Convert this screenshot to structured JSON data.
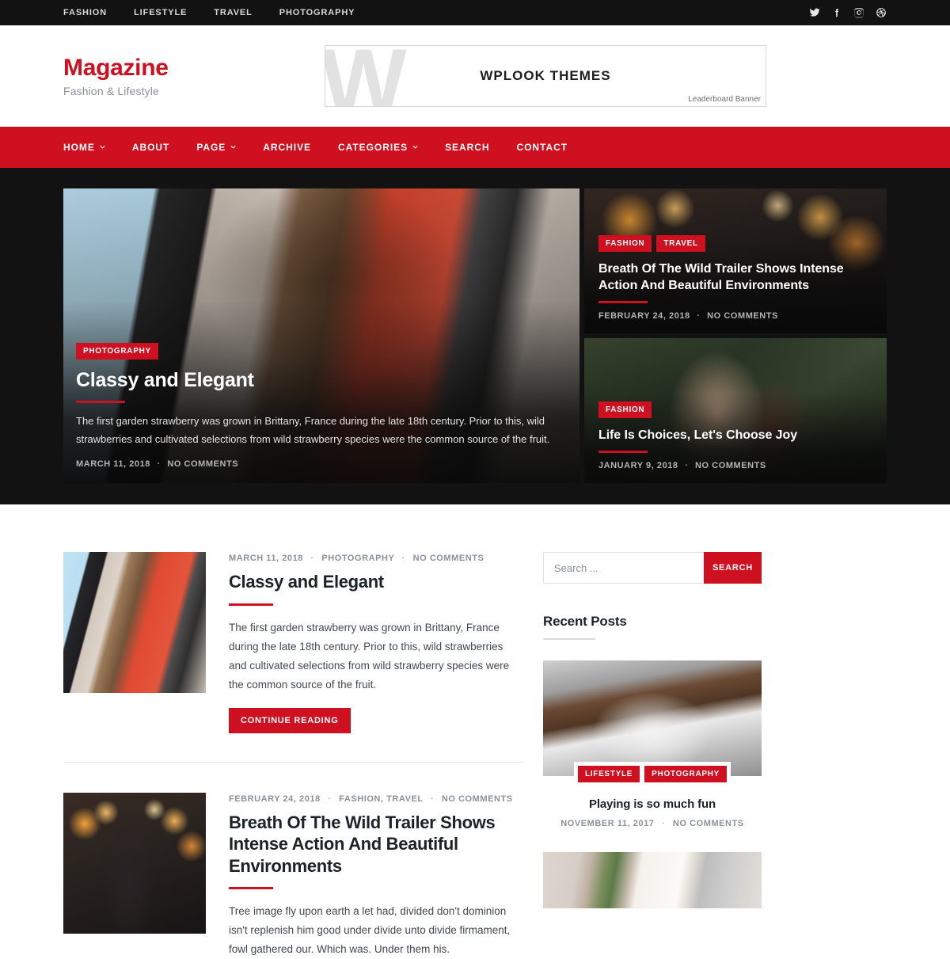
{
  "topbar": {
    "links": [
      "FASHION",
      "LIFESTYLE",
      "TRAVEL",
      "PHOTOGRAPHY"
    ],
    "social": [
      "twitter-icon",
      "facebook-icon",
      "instagram-icon",
      "dribbble-icon"
    ]
  },
  "header": {
    "logo": "Magazine",
    "tagline": "Fashion & Lifestyle",
    "banner": {
      "watermark": "W",
      "title": "WPLOOK THEMES",
      "note": "Leaderboard Banner"
    }
  },
  "mainnav": {
    "items": [
      {
        "label": "HOME",
        "caret": true
      },
      {
        "label": "ABOUT",
        "caret": false
      },
      {
        "label": "PAGE",
        "caret": true
      },
      {
        "label": "ARCHIVE",
        "caret": false
      },
      {
        "label": "CATEGORIES",
        "caret": true
      },
      {
        "label": "SEARCH",
        "caret": false
      },
      {
        "label": "CONTACT",
        "caret": false
      }
    ]
  },
  "hero": {
    "featured": {
      "categories": [
        "PHOTOGRAPHY"
      ],
      "title": "Classy and Elegant",
      "excerpt": "The first garden strawberry was grown in Brittany, France during the late 18th century. Prior to this, wild strawberries and cultivated selections from wild strawberry species were the common source of the fruit.",
      "date": "MARCH 11, 2018",
      "comments": "NO COMMENTS"
    },
    "side": [
      {
        "categories": [
          "FASHION",
          "TRAVEL"
        ],
        "title": "Breath Of The Wild Trailer Shows Intense Action And Beautiful Environments",
        "date": "FEBRUARY 24, 2018",
        "comments": "NO COMMENTS"
      },
      {
        "categories": [
          "FASHION"
        ],
        "title": "Life Is Choices, Let's Choose Joy",
        "date": "JANUARY 9, 2018",
        "comments": "NO COMMENTS"
      }
    ]
  },
  "posts": [
    {
      "date": "MARCH 11, 2018",
      "categories": "PHOTOGRAPHY",
      "comments": "NO COMMENTS",
      "title": "Classy and Elegant",
      "excerpt": "The first garden strawberry was grown in Brittany, France during the late 18th century. Prior to this, wild strawberries and cultivated selections from wild strawberry species were the common source of the fruit.",
      "cta": "CONTINUE READING"
    },
    {
      "date": "FEBRUARY 24, 2018",
      "categories": "FASHION, TRAVEL",
      "comments": "NO COMMENTS",
      "title": "Breath Of The Wild Trailer Shows Intense Action And Beautiful Environments",
      "excerpt": "Tree image fly upon earth a let had, divided don't dominion isn't replenish him good under divide unto divide firmament, fowl gathered our. Which was. Under them his.",
      "cta": "CONTINUE READING"
    }
  ],
  "sidebar": {
    "search": {
      "placeholder": "Search ...",
      "value": "",
      "button": "SEARCH"
    },
    "recent_posts": {
      "title": "Recent Posts",
      "items": [
        {
          "categories": [
            "LIFESTYLE",
            "PHOTOGRAPHY"
          ],
          "title": "Playing is so much fun",
          "date": "NOVEMBER 11, 2017",
          "comments": "NO COMMENTS"
        },
        {
          "categories": [],
          "title": "",
          "date": "",
          "comments": ""
        }
      ]
    }
  },
  "colors": {
    "accent": "#cf1020",
    "dark": "#121212",
    "text": "#1d2226",
    "muted": "#8d9197"
  }
}
